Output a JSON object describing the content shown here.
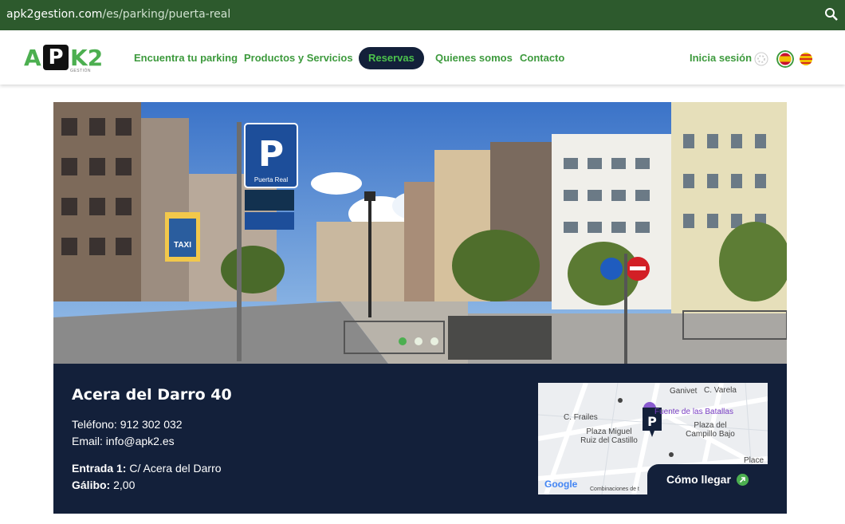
{
  "browser": {
    "url_host": "apk2gestion.com",
    "url_path": "/es/parking/puerta-real"
  },
  "header": {
    "logo": {
      "brand": "APK2",
      "tagline": "GESTIÓN"
    },
    "nav": [
      {
        "label": "Encuentra tu parking"
      },
      {
        "label": "Productos y Servicios"
      },
      {
        "label": "Reservas",
        "active": true
      },
      {
        "label": "Quienes somos"
      },
      {
        "label": "Contacto"
      }
    ],
    "login_label": "Inicia sesión",
    "languages": [
      "en-icon",
      "es-flag-icon",
      "ca-flag-icon"
    ]
  },
  "hero": {
    "signs": {
      "parking": "P",
      "parking_name": "Puerta Real",
      "taxi": "TAXI"
    },
    "carousel": {
      "total": 3,
      "active": 1
    }
  },
  "parking": {
    "name": "Acera del Darro 40",
    "phone_label": "Teléfono:",
    "phone": "912 302 032",
    "email_label": "Email:",
    "email": "info@apk2.es",
    "entrance_label": "Entrada 1:",
    "entrance": "C/ Acera del Darro",
    "clearance_label": "Gálibo:",
    "clearance": "2,00"
  },
  "map": {
    "labels": {
      "ganivet": "Ganivet",
      "varela": "C. Varela",
      "fuente": "Fuente de las Batallas",
      "frailes": "C. Frailes",
      "plaza_campillo": "Plaza del Campillo Bajo",
      "plaza_miguel": "Plaza Miguel Ruiz del Castillo",
      "place": "Place",
      "google": "Google",
      "combinaciones": "Combinaciones de t"
    },
    "directions_label": "Cómo llegar"
  },
  "colors": {
    "green": "#4caf50",
    "navy": "#13203a",
    "urlbar": "#2d5a2d"
  }
}
